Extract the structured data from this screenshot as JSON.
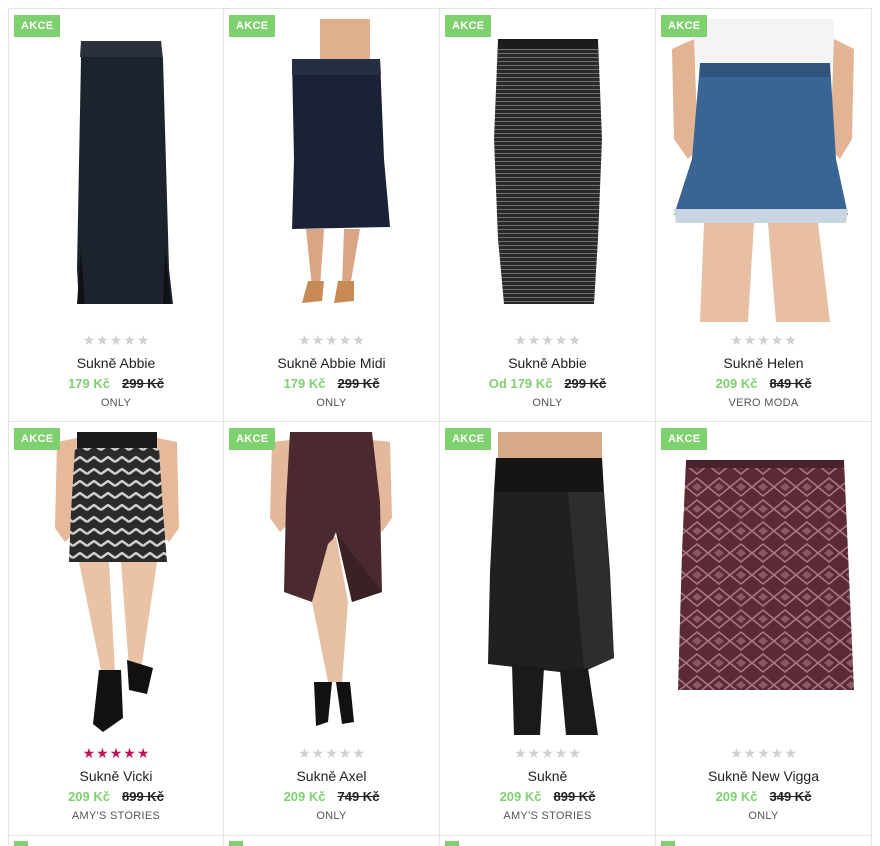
{
  "products": [
    {
      "badge": "AKCE",
      "name": "Sukně Abbie",
      "price": "179 Kč",
      "old_price": "299 Kč",
      "brand": "ONLY",
      "rating": 0
    },
    {
      "badge": "AKCE",
      "name": "Sukně Abbie Midi",
      "price": "179 Kč",
      "old_price": "299 Kč",
      "brand": "ONLY",
      "rating": 0
    },
    {
      "badge": "AKCE",
      "name": "Sukně Abbie",
      "price": "Od 179 Kč",
      "old_price": "299 Kč",
      "brand": "ONLY",
      "rating": 0
    },
    {
      "badge": "AKCE",
      "name": "Sukně Helen",
      "price": "209 Kč",
      "old_price": "849 Kč",
      "brand": "VERO MODA",
      "rating": 0
    },
    {
      "badge": "AKCE",
      "name": "Sukně Vicki",
      "price": "209 Kč",
      "old_price": "899 Kč",
      "brand": "AMY'S STORIES",
      "rating": 5
    },
    {
      "badge": "AKCE",
      "name": "Sukně Axel",
      "price": "209 Kč",
      "old_price": "749 Kč",
      "brand": "ONLY",
      "rating": 0
    },
    {
      "badge": "AKCE",
      "name": "Sukně",
      "price": "209 Kč",
      "old_price": "899 Kč",
      "brand": "AMY'S STORIES",
      "rating": 0
    },
    {
      "badge": "AKCE",
      "name": "Sukně New Vigga",
      "price": "209 Kč",
      "old_price": "349 Kč",
      "brand": "ONLY",
      "rating": 0
    }
  ],
  "star_glyph": "★",
  "colors": {
    "badge": "#7fd06f",
    "price": "#7fd06f",
    "rating_on": "#c4115a",
    "rating_off": "#d0d0d0"
  },
  "images": [
    "black-maxi-skirt",
    "navy-midi-skirt",
    "striped-pencil-skirt",
    "denim-mini-skirt",
    "zigzag-mini-skirt",
    "burgundy-wrap-skirt",
    "black-leather-skirt",
    "burgundy-aztec-skirt"
  ]
}
